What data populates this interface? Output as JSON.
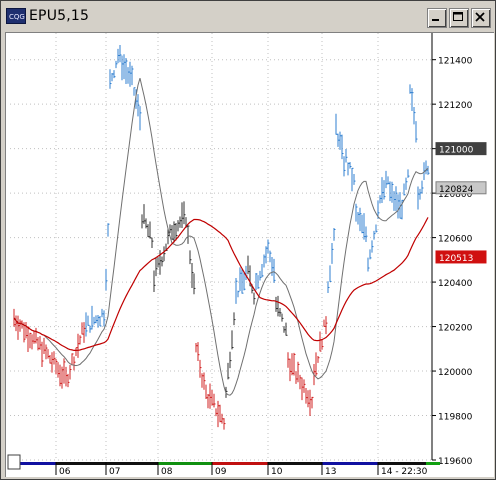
{
  "window": {
    "title": "EPU5,15",
    "icon": "chart-app-icon",
    "controls": [
      "minimize-icon",
      "maximize-icon",
      "close-icon"
    ]
  },
  "chart_data": {
    "type": "bar",
    "title": "EPU5,15",
    "y_ticks": [
      "121400",
      "121200",
      "121000",
      "120800",
      "120600",
      "120400",
      "120200",
      "120000",
      "119800",
      "119600"
    ],
    "ylim": [
      119600,
      121520
    ],
    "x_ticks": [
      "06",
      "07",
      "08",
      "09",
      "10",
      "13",
      "14 - 22:30"
    ],
    "price_labels": {
      "last_price": "121000",
      "ma_fast": "120824",
      "ma_slow": "120513"
    },
    "colors": {
      "up": "#2f7fd0",
      "down": "#d02020",
      "neutral": "#303030",
      "ma_fast": "#707070",
      "ma_slow": "#c00000",
      "grid": "#c0c0c0",
      "last_price_tag": "#404040",
      "ma_fast_tag": "#808080",
      "ma_slow_tag": "#d01010"
    },
    "session_colors": [
      "#1010a0",
      "#101010",
      "#101010",
      "#109010",
      "#c01010",
      "#101010",
      "#1010a0",
      "#101010",
      "#10a010"
    ],
    "grid": true
  }
}
